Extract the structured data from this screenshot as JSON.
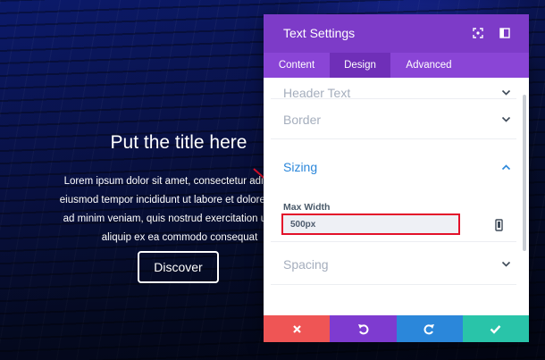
{
  "hero": {
    "title": "Put the title here",
    "body_lines": [
      "Lorem ipsum dolor sit amet, consectetur adipiscing",
      "eiusmod tempor incididunt ut labore et dolore magna",
      "ad minim veniam, quis nostrud exercitation ullamco",
      "aliquip ex ea commodo consequat"
    ],
    "button_label": "Discover"
  },
  "panel": {
    "title": "Text Settings",
    "header_icons": [
      "fullscreen-icon",
      "sidebar-toggle-icon"
    ],
    "tabs": [
      {
        "label": "Content",
        "active": false
      },
      {
        "label": "Design",
        "active": true
      },
      {
        "label": "Advanced",
        "active": false
      }
    ],
    "sections": [
      {
        "label": "Header Text",
        "expanded": false
      },
      {
        "label": "Border",
        "expanded": false
      },
      {
        "label": "Sizing",
        "expanded": true
      },
      {
        "label": "Spacing",
        "expanded": false
      }
    ],
    "sizing": {
      "field_label": "Max Width",
      "field_value": "500px",
      "device_icon": "phone-icon"
    },
    "footer_buttons": [
      {
        "name": "discard",
        "icon": "close-icon",
        "color": "#ef5555"
      },
      {
        "name": "undo",
        "icon": "undo-icon",
        "color": "#7e3bd0"
      },
      {
        "name": "redo",
        "icon": "redo-icon",
        "color": "#2b87da"
      },
      {
        "name": "save",
        "icon": "check-icon",
        "color": "#29c4a9"
      }
    ]
  },
  "colors": {
    "header": "#7d3bc8",
    "tabs": "#8a45d6",
    "active_tab": "#6f2fb8",
    "accent_text": "#2b87da",
    "highlight": "#e3112a"
  }
}
